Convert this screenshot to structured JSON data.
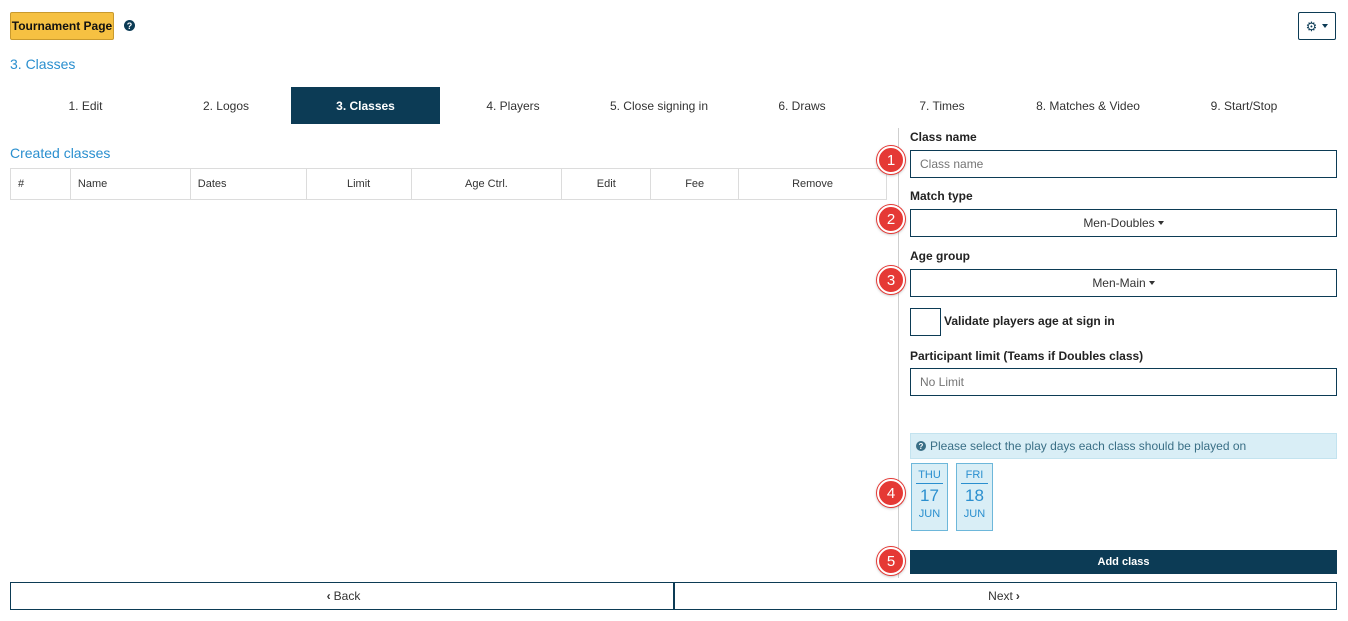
{
  "header": {
    "tournament_page_label": "Tournament Page",
    "help_glyph": "?",
    "settings_glyph": "⚙"
  },
  "page_title": "3. Classes",
  "steps": [
    {
      "label": "1. Edit",
      "active": false
    },
    {
      "label": "2. Logos",
      "active": false
    },
    {
      "label": "3. Classes",
      "active": true
    },
    {
      "label": "4. Players",
      "active": false
    },
    {
      "label": "5. Close signing in",
      "active": false
    },
    {
      "label": "6. Draws",
      "active": false
    },
    {
      "label": "7. Times",
      "active": false
    },
    {
      "label": "8. Matches & Video",
      "active": false
    },
    {
      "label": "9. Start/Stop",
      "active": false
    }
  ],
  "created_classes": {
    "title": "Created classes",
    "columns": [
      "#",
      "Name",
      "Dates",
      "Limit",
      "Age Ctrl.",
      "Edit",
      "Fee",
      "Remove"
    ],
    "rows": []
  },
  "form": {
    "class_name_label": "Class name",
    "class_name_placeholder": "Class name",
    "match_type_label": "Match type",
    "match_type_value": "Men-Doubles",
    "age_group_label": "Age group",
    "age_group_value": "Men-Main",
    "validate_age_label": "Validate players age at sign in",
    "validate_age_checked": false,
    "participant_limit_label": "Participant limit (Teams if Doubles class)",
    "participant_limit_placeholder": "No Limit",
    "play_days_info": "Please select the play days each class should be played on",
    "days": [
      {
        "dow": "THU",
        "day": "17",
        "month": "JUN"
      },
      {
        "dow": "FRI",
        "day": "18",
        "month": "JUN"
      }
    ],
    "add_class_label": "Add class"
  },
  "markers": [
    "1",
    "2",
    "3",
    "4",
    "5"
  ],
  "footer": {
    "back_label": "Back",
    "next_label": "Next"
  },
  "colors": {
    "primary": "#0c3b55",
    "accent_blue": "#2a8fcf",
    "tournament_button": "#f6c142",
    "info_background": "#d9eef6",
    "marker_red": "#e53935"
  }
}
